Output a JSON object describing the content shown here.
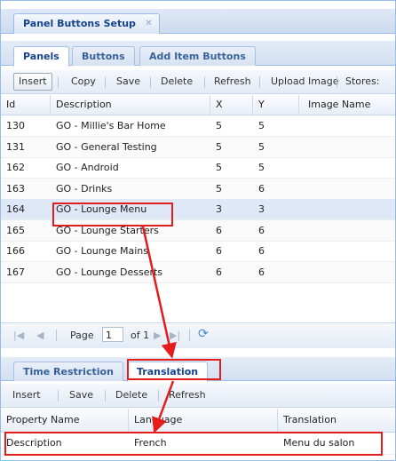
{
  "document_tab": {
    "label": "Panel Buttons Setup"
  },
  "top_tabs": [
    {
      "label": "Panels",
      "active": true
    },
    {
      "label": "Buttons",
      "active": false
    },
    {
      "label": "Add Item Buttons",
      "active": false
    }
  ],
  "panels_toolbar": {
    "insert": "Insert",
    "copy": "Copy",
    "save": "Save",
    "delete": "Delete",
    "refresh": "Refresh",
    "upload_image": "Upload Image",
    "stores": "Stores:"
  },
  "panels_grid": {
    "columns": [
      "Id",
      "Description",
      "X",
      "Y",
      "Image Name"
    ],
    "rows": [
      {
        "id": "130",
        "description": "GO - Millie's Bar Home",
        "x": "5",
        "y": "5"
      },
      {
        "id": "131",
        "description": "GO - General Testing",
        "x": "5",
        "y": "5"
      },
      {
        "id": "162",
        "description": "GO - Android",
        "x": "5",
        "y": "5"
      },
      {
        "id": "163",
        "description": "GO - Drinks",
        "x": "5",
        "y": "6"
      },
      {
        "id": "164",
        "description": "GO - Lounge Menu",
        "x": "3",
        "y": "3"
      },
      {
        "id": "165",
        "description": "GO - Lounge Starters",
        "x": "6",
        "y": "6"
      },
      {
        "id": "166",
        "description": "GO - Lounge Mains",
        "x": "6",
        "y": "6"
      },
      {
        "id": "167",
        "description": "GO - Lounge Desserts",
        "x": "6",
        "y": "6"
      }
    ]
  },
  "pager": {
    "page_label": "Page",
    "page_value": "1",
    "of_label": "of 1"
  },
  "bottom_tabs": [
    {
      "label": "Time Restriction",
      "active": false
    },
    {
      "label": "Translation",
      "active": true
    }
  ],
  "translation_toolbar": {
    "insert": "Insert",
    "save": "Save",
    "delete": "Delete",
    "refresh": "Refresh"
  },
  "translation_grid": {
    "columns": [
      "Property Name",
      "Language",
      "Translation"
    ],
    "rows": [
      {
        "property": "Description",
        "language": "French",
        "translation": "Menu du salon"
      }
    ]
  },
  "colors": {
    "accent": "#15428b",
    "highlight": "#e31c1c",
    "selected_row": "#dfe8f6"
  }
}
